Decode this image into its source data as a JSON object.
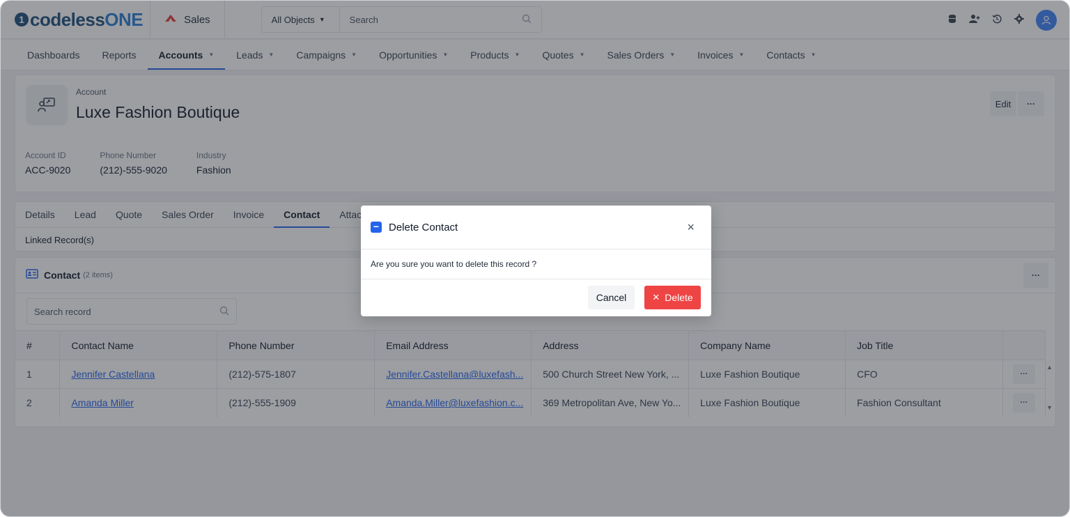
{
  "app": {
    "logo_mark": "1",
    "logo_text_a": "codeless",
    "logo_text_b": "ONE",
    "app_name": "Sales"
  },
  "search": {
    "scope": "All Objects",
    "placeholder": "Search"
  },
  "nav": {
    "items": [
      {
        "label": "Dashboards",
        "dropdown": false
      },
      {
        "label": "Reports",
        "dropdown": false
      },
      {
        "label": "Accounts",
        "dropdown": true,
        "active": true
      },
      {
        "label": "Leads",
        "dropdown": true
      },
      {
        "label": "Campaigns",
        "dropdown": true
      },
      {
        "label": "Opportunities",
        "dropdown": true
      },
      {
        "label": "Products",
        "dropdown": true
      },
      {
        "label": "Quotes",
        "dropdown": true
      },
      {
        "label": "Sales Orders",
        "dropdown": true
      },
      {
        "label": "Invoices",
        "dropdown": true
      },
      {
        "label": "Contacts",
        "dropdown": true
      }
    ]
  },
  "record": {
    "type": "Account",
    "name": "Luxe Fashion Boutique",
    "edit_label": "Edit",
    "more_label": "···",
    "fields": [
      {
        "label": "Account ID",
        "value": "ACC-9020"
      },
      {
        "label": "Phone Number",
        "value": "(212)-555-9020"
      },
      {
        "label": "Industry",
        "value": "Fashion"
      }
    ]
  },
  "tabs": {
    "items": [
      "Details",
      "Lead",
      "Quote",
      "Sales Order",
      "Invoice",
      "Contact",
      "Attac"
    ],
    "active": "Contact",
    "linked_label": "Linked Record(s)"
  },
  "contact_list": {
    "title": "Contact",
    "count": "(2 items)",
    "search_placeholder": "Search record",
    "columns": [
      "#",
      "Contact Name",
      "Phone Number",
      "Email Address",
      "Address",
      "Company Name",
      "Job Title"
    ],
    "rows": [
      {
        "num": "1",
        "name": "Jennifer Castellana",
        "phone": "(212)-575-1807",
        "email": "Jennifer.Castellana@luxefash...",
        "address": "500 Church Street New York, ...",
        "company": "Luxe Fashion Boutique",
        "job": "CFO"
      },
      {
        "num": "2",
        "name": "Amanda Miller",
        "phone": "(212)-555-1909",
        "email": "Amanda.Miller@luxefashion.c...",
        "address": "369 Metropolitan Ave, New Yo...",
        "company": "Luxe Fashion Boutique",
        "job": "Fashion Consultant"
      }
    ],
    "row_more": "···"
  },
  "modal": {
    "title": "Delete Contact",
    "message": "Are you sure you want to delete this record ?",
    "cancel_label": "Cancel",
    "delete_label": "Delete",
    "close_glyph": "×"
  },
  "colors": {
    "accent": "#2563eb",
    "danger": "#ef4444",
    "brand_dark": "#1d4f7a",
    "brand_light": "#2a7fd4"
  }
}
